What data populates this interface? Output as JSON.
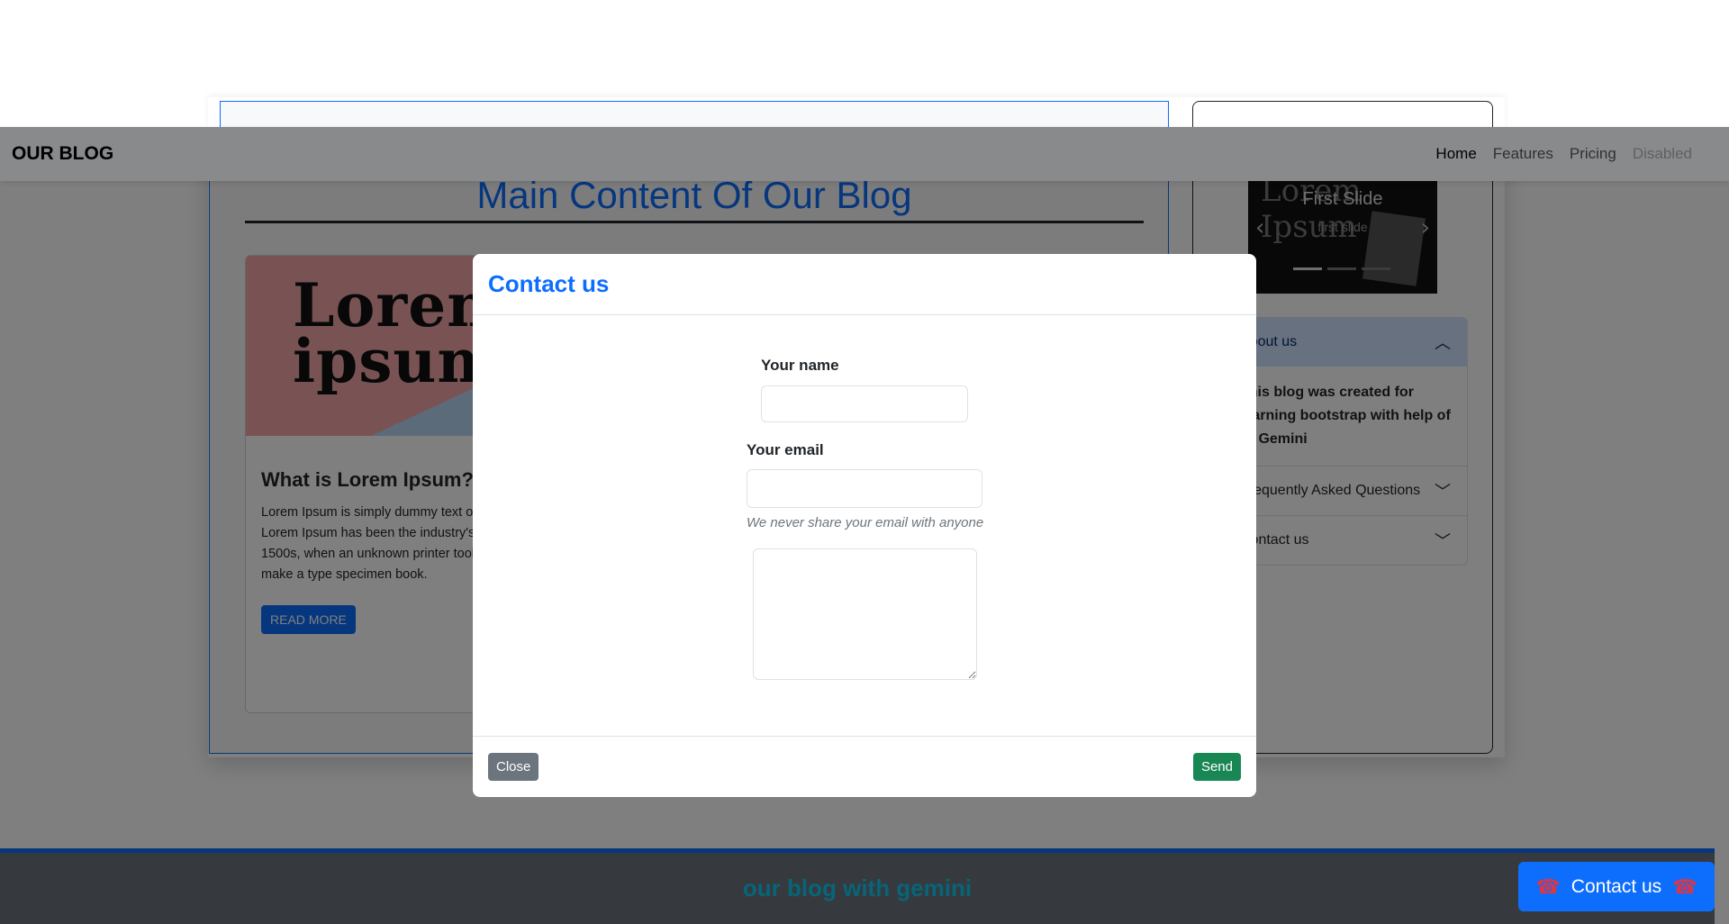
{
  "navbar": {
    "brand": "OUR BLOG",
    "links": [
      "Home",
      "Features",
      "Pricing",
      "Disabled"
    ]
  },
  "main": {
    "title": "Main Content Of Our Blog",
    "post": {
      "image_text": "Lorem ipsum",
      "title": "What is Lorem Ipsum?",
      "text": "Lorem Ipsum is simply dummy text of the printing and typesetting industry. Lorem Ipsum has been the industry's standard dummy text ever since the 1500s, when an unknown printer took a galley of type and scrambled it to make a type specimen book.",
      "button": "READ MORE"
    }
  },
  "sidebar": {
    "carousel": {
      "bg_text": "Lorem Ipsum",
      "caption": "First Slide",
      "subcaption": "first slide"
    },
    "accordion": [
      {
        "title": "About us",
        "body": "This blog was created for learning bootstrap with help of AI Gemini",
        "open": true
      },
      {
        "title": "Frequently Asked Questions",
        "open": false
      },
      {
        "title": "Contact us",
        "open": false
      }
    ]
  },
  "footer": {
    "text": "our blog with gemini",
    "contact_button": "Contact us"
  },
  "modal": {
    "title": "Contact us",
    "name_label": "Your name",
    "name_value": "",
    "email_label": "Your email",
    "email_value": "",
    "email_hint": "We never share your email with anyone",
    "message_value": "",
    "close_button": "Close",
    "send_button": "Send"
  },
  "colors": {
    "primary": "#0d6efd",
    "success": "#198754",
    "secondary": "#6c757d",
    "info": "#0dcaf0",
    "danger": "#dc3545"
  }
}
